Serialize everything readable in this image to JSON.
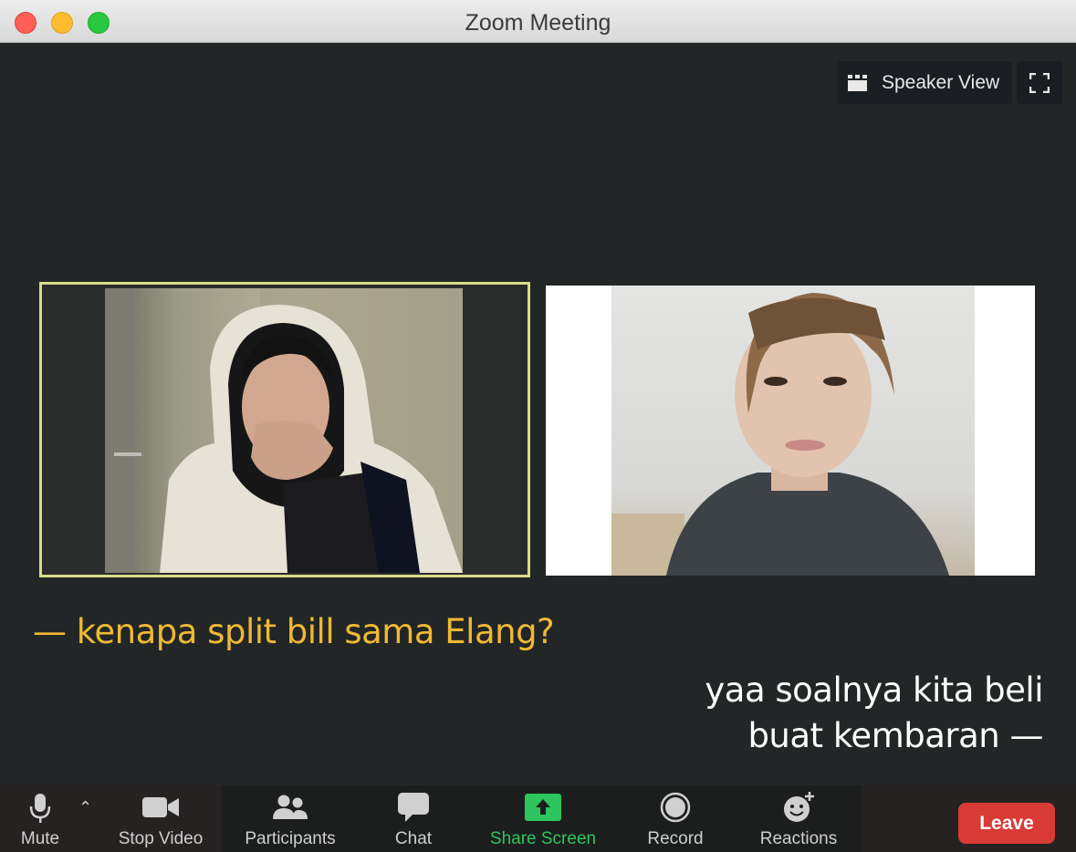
{
  "window": {
    "title": "Zoom Meeting"
  },
  "view_controls": {
    "speaker_view_label": "Speaker View"
  },
  "captions": {
    "left": "— kenapa split bill sama Elang?",
    "right_line1": "yaa soalnya kita beli",
    "right_line2": "buat kembaran —"
  },
  "toolbar": {
    "mute": "Mute",
    "stop_video": "Stop Video",
    "participants": "Participants",
    "chat": "Chat",
    "share_screen": "Share Screen",
    "record": "Record",
    "reactions": "Reactions",
    "leave": "Leave"
  },
  "colors": {
    "active_speaker_border": "#d8dc86",
    "caption_left": "#efb934",
    "share_green": "#2dc55e",
    "leave_red": "#d83b36"
  }
}
